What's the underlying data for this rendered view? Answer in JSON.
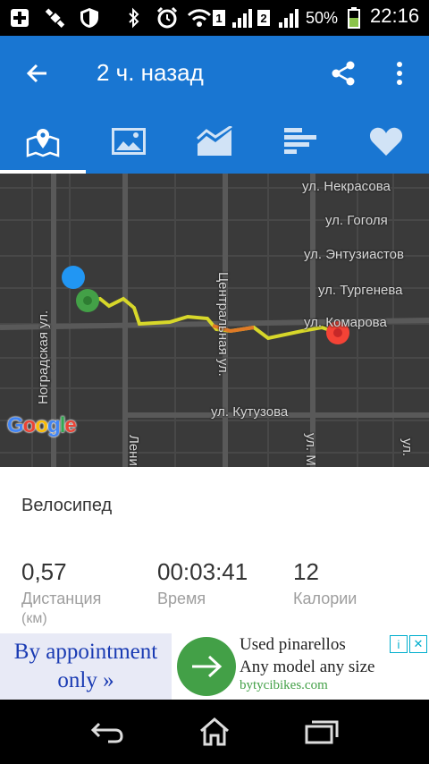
{
  "status_bar": {
    "sim1": "1",
    "sim2": "2",
    "battery_percent": "50%",
    "time": "22:16"
  },
  "app_bar": {
    "title": "2 ч. назад"
  },
  "tabs": [
    {
      "name": "map",
      "icon": "map-icon",
      "active": true
    },
    {
      "name": "photos",
      "icon": "image-icon",
      "active": false
    },
    {
      "name": "charts",
      "icon": "area-chart-icon",
      "active": false
    },
    {
      "name": "laps",
      "icon": "bars-icon",
      "active": false
    },
    {
      "name": "heart",
      "icon": "heart-icon",
      "active": false
    }
  ],
  "map": {
    "streets": {
      "nekrasova": "ул. Некрасова",
      "gogolya": "ул. Гоголя",
      "entuziastov": "ул. Энтузиастов",
      "turgeneva": "ул. Тургенева",
      "komarova": "ул. Комарова",
      "kutuzova": "ул. Кутузова",
      "nogradskaya": "Ноградская ул.",
      "centralnaya": "Центральная ул.",
      "lenina_partial": "Ленина",
      "ul_m_partial": "ул. М",
      "right_edge_partial": "ул."
    },
    "logo": "Google",
    "colors": {
      "route": "#d7d72a",
      "route_fast": "#e07a26",
      "start": "#43a047",
      "end": "#f44336",
      "location": "#2196f3"
    }
  },
  "activity": {
    "type": "Велосипед",
    "stats": [
      {
        "value": "0,57",
        "label": "Дистанция",
        "unit": "(км)"
      },
      {
        "value": "00:03:41",
        "label": "Время",
        "unit": ""
      },
      {
        "value": "12",
        "label": "Калории",
        "unit": ""
      }
    ]
  },
  "ad": {
    "left_line1": "By appointment",
    "left_line2": "only »",
    "line1": "Used pinarellos",
    "line2": "Any model any size",
    "url": "bytycibikes.com",
    "badge_info": "i",
    "badge_close": "✕"
  },
  "colors": {
    "primary": "#1976d2",
    "map_bg": "#3a3a3a"
  }
}
